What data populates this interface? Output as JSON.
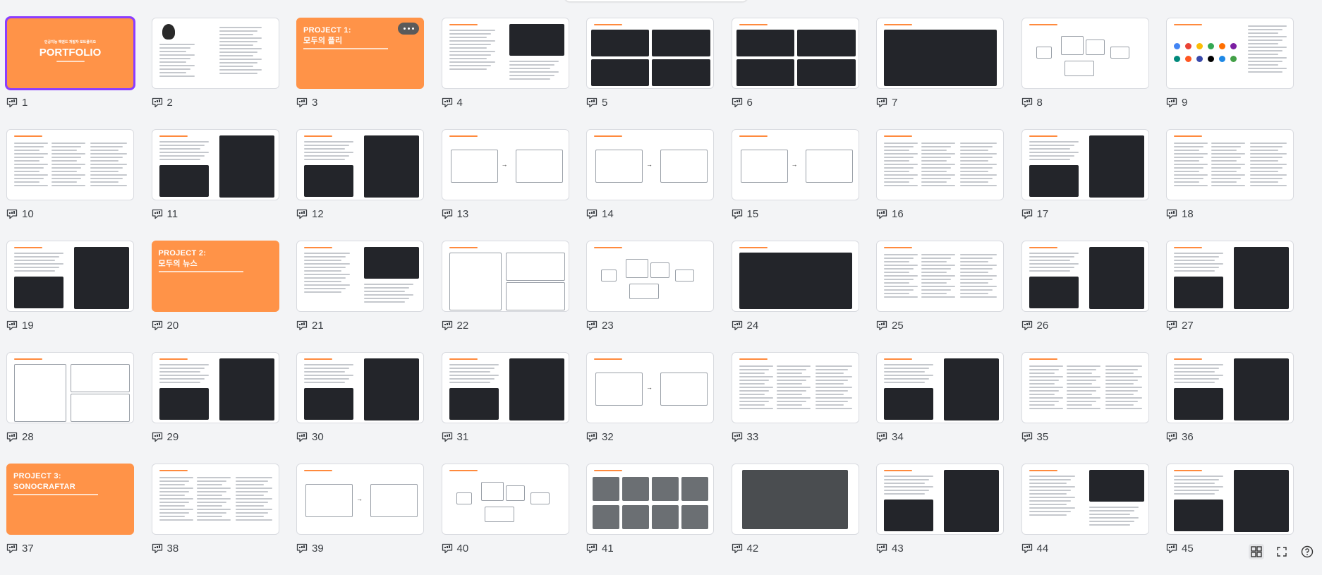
{
  "colors": {
    "accent_orange": "#ff9348",
    "selection": "#8b3dff",
    "background": "#f3f4f6"
  },
  "slide_icon": "presentation-comment-icon",
  "texts": {
    "s1_small": "인공지능 백엔드 개발자 포트폴리오",
    "s1_title": "PORTFOLIO",
    "s3_title": "PROJECT 1:",
    "s3_sub": "모두의 플리",
    "s20_title": "PROJECT 2:",
    "s20_sub": "모두의 뉴스",
    "s37_title": "PROJECT 3:",
    "s37_sub": "SONOCRAFTAR"
  },
  "slides": [
    {
      "n": "1",
      "kind": "cover"
    },
    {
      "n": "2",
      "kind": "profile"
    },
    {
      "n": "3",
      "kind": "project1"
    },
    {
      "n": "4",
      "kind": "text-image"
    },
    {
      "n": "5",
      "kind": "dark-grid"
    },
    {
      "n": "6",
      "kind": "dark-grid"
    },
    {
      "n": "7",
      "kind": "dark-single"
    },
    {
      "n": "8",
      "kind": "diagram"
    },
    {
      "n": "9",
      "kind": "logos"
    },
    {
      "n": "10",
      "kind": "text-cols"
    },
    {
      "n": "11",
      "kind": "code"
    },
    {
      "n": "12",
      "kind": "code"
    },
    {
      "n": "13",
      "kind": "flow"
    },
    {
      "n": "14",
      "kind": "flow"
    },
    {
      "n": "15",
      "kind": "flow"
    },
    {
      "n": "16",
      "kind": "text-cols"
    },
    {
      "n": "17",
      "kind": "code"
    },
    {
      "n": "18",
      "kind": "text-cols"
    },
    {
      "n": "19",
      "kind": "code"
    },
    {
      "n": "20",
      "kind": "project2"
    },
    {
      "n": "21",
      "kind": "text-image"
    },
    {
      "n": "22",
      "kind": "screens"
    },
    {
      "n": "23",
      "kind": "diagram"
    },
    {
      "n": "24",
      "kind": "dark-single"
    },
    {
      "n": "25",
      "kind": "text-cols"
    },
    {
      "n": "26",
      "kind": "code"
    },
    {
      "n": "27",
      "kind": "code"
    },
    {
      "n": "28",
      "kind": "screens"
    },
    {
      "n": "29",
      "kind": "code"
    },
    {
      "n": "30",
      "kind": "code"
    },
    {
      "n": "31",
      "kind": "code"
    },
    {
      "n": "32",
      "kind": "flow"
    },
    {
      "n": "33",
      "kind": "text-cols"
    },
    {
      "n": "34",
      "kind": "code"
    },
    {
      "n": "35",
      "kind": "text-cols"
    },
    {
      "n": "36",
      "kind": "code"
    },
    {
      "n": "37",
      "kind": "project3"
    },
    {
      "n": "38",
      "kind": "text-cols"
    },
    {
      "n": "39",
      "kind": "flow"
    },
    {
      "n": "40",
      "kind": "diagram"
    },
    {
      "n": "41",
      "kind": "photos"
    },
    {
      "n": "42",
      "kind": "photo"
    },
    {
      "n": "43",
      "kind": "code"
    },
    {
      "n": "44",
      "kind": "text-image"
    },
    {
      "n": "45",
      "kind": "code"
    }
  ],
  "tools": {
    "grid": "grid-view-icon",
    "fullscreen": "fullscreen-icon",
    "help": "help-icon"
  }
}
